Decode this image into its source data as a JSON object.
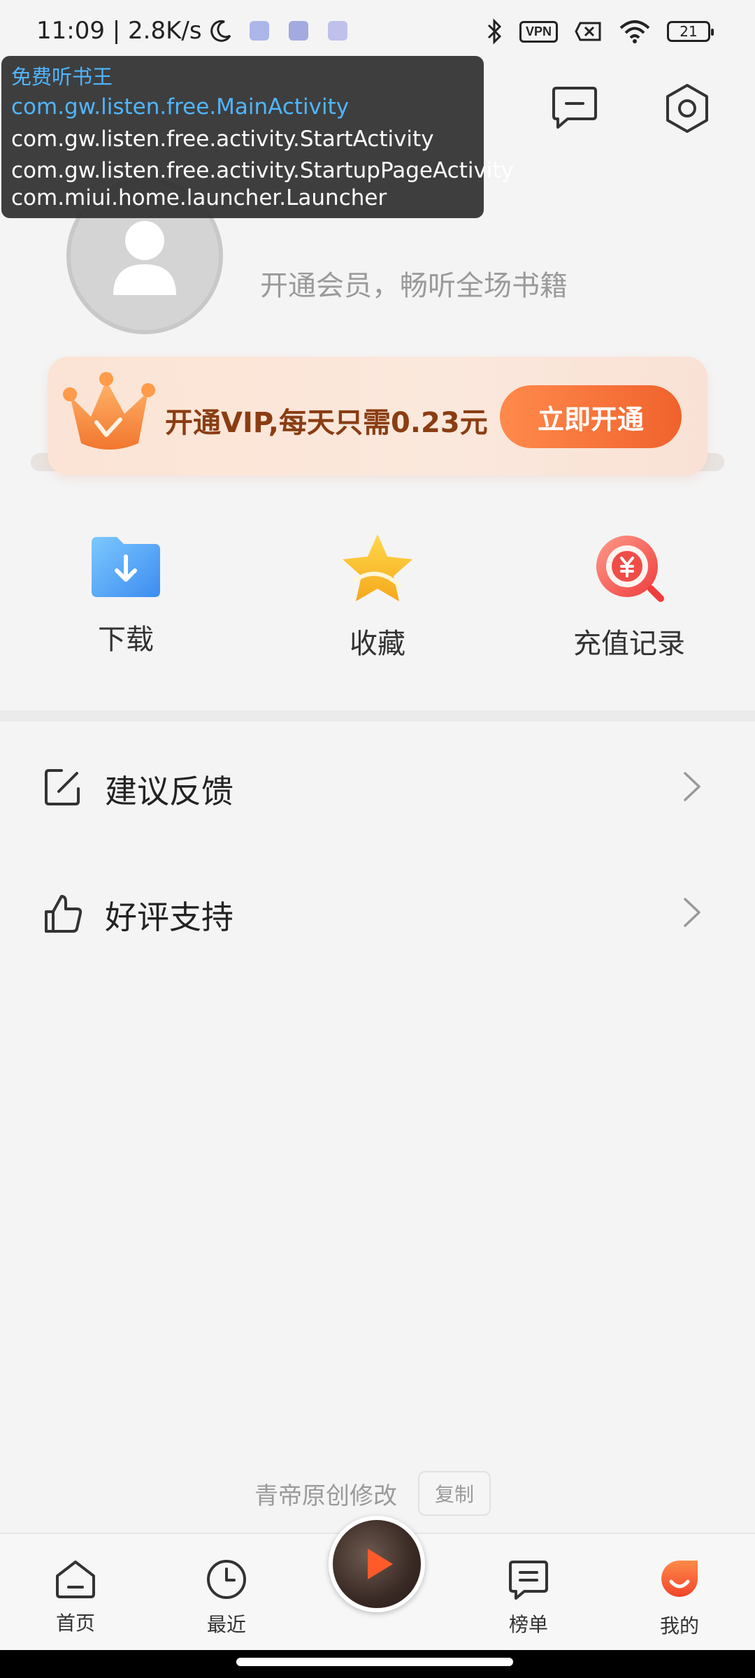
{
  "status_bar": {
    "time_speed": "11:09 | 2.8K/s",
    "vpn": "VPN",
    "battery": "21"
  },
  "debug_overlay": {
    "app_name": "免费听书王",
    "lines": [
      "com.gw.listen.free.MainActivity",
      "com.gw.listen.free.activity.StartActivity",
      "com.gw.listen.free.activity.StartupPageActivity",
      "com.miui.home.launcher.Launcher"
    ]
  },
  "profile": {
    "prompt": "开通会员，畅听全场书籍"
  },
  "vip_banner": {
    "text": "开通VIP,每天只需0.23元",
    "button": "立即开通"
  },
  "quick_actions": [
    {
      "label": "下载",
      "icon": "download-folder-icon"
    },
    {
      "label": "收藏",
      "icon": "star-icon"
    },
    {
      "label": "充值记录",
      "icon": "yuan-search-icon"
    }
  ],
  "menu": [
    {
      "label": "建议反馈",
      "icon": "edit-icon"
    },
    {
      "label": "好评支持",
      "icon": "thumbs-up-icon"
    }
  ],
  "credit": {
    "text": "青帝原创修改",
    "copy": "复制"
  },
  "bottom_nav": [
    {
      "label": "首页",
      "icon": "home-icon"
    },
    {
      "label": "最近",
      "icon": "clock-icon"
    },
    {
      "label": "榜单",
      "icon": "list-chat-icon"
    },
    {
      "label": "我的",
      "icon": "profile-circle-icon"
    }
  ],
  "colors": {
    "accent_orange": "#f0622c",
    "overlay_blue": "#4fb6ff"
  }
}
